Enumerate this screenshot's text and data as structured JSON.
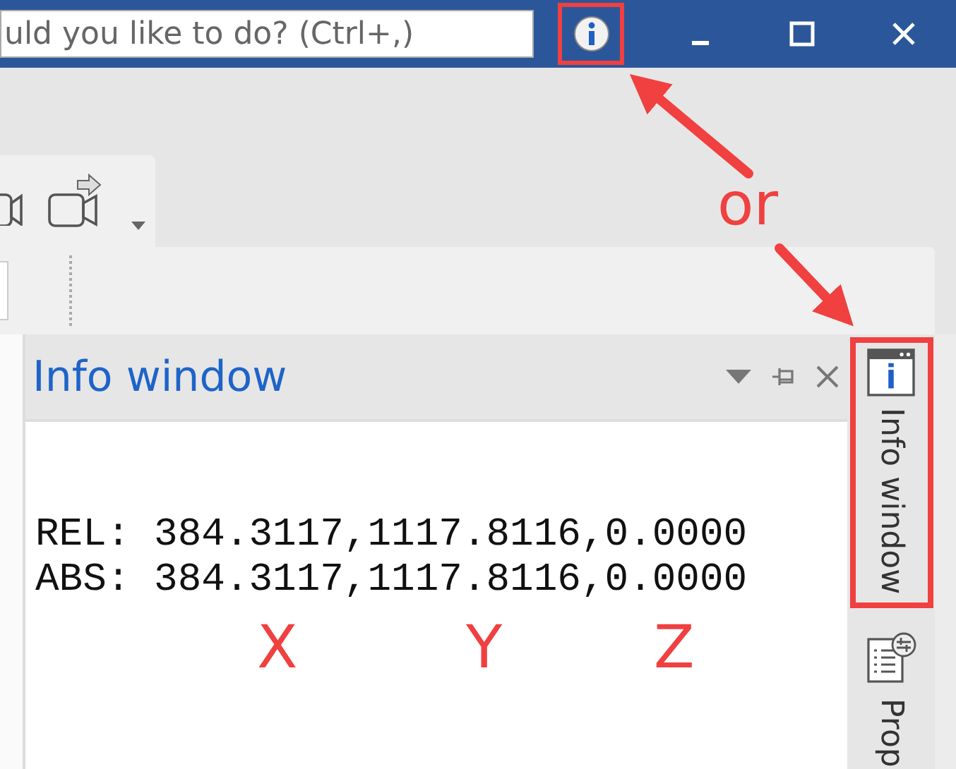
{
  "title_bar": {
    "search": {
      "placeholder": "uld you like to do? (Ctrl+,)"
    },
    "info_button": {
      "highlighted": true
    },
    "controls": [
      {
        "kind": "minimize"
      },
      {
        "kind": "maximize"
      },
      {
        "kind": "close"
      }
    ]
  },
  "info_panel": {
    "title": "Info window",
    "lines": [
      "REL: 384.3117,1117.8116,0.0000",
      "ABS: 384.3117,1117.8116,0.0000"
    ]
  },
  "side_tabs": [
    {
      "label": "Info window",
      "kind": "info",
      "highlighted": true
    },
    {
      "label": "Prop",
      "kind": "properties",
      "highlighted": false
    }
  ],
  "annotations": {
    "connector": "or",
    "axis_labels": [
      "X",
      "Y",
      "Z"
    ]
  }
}
